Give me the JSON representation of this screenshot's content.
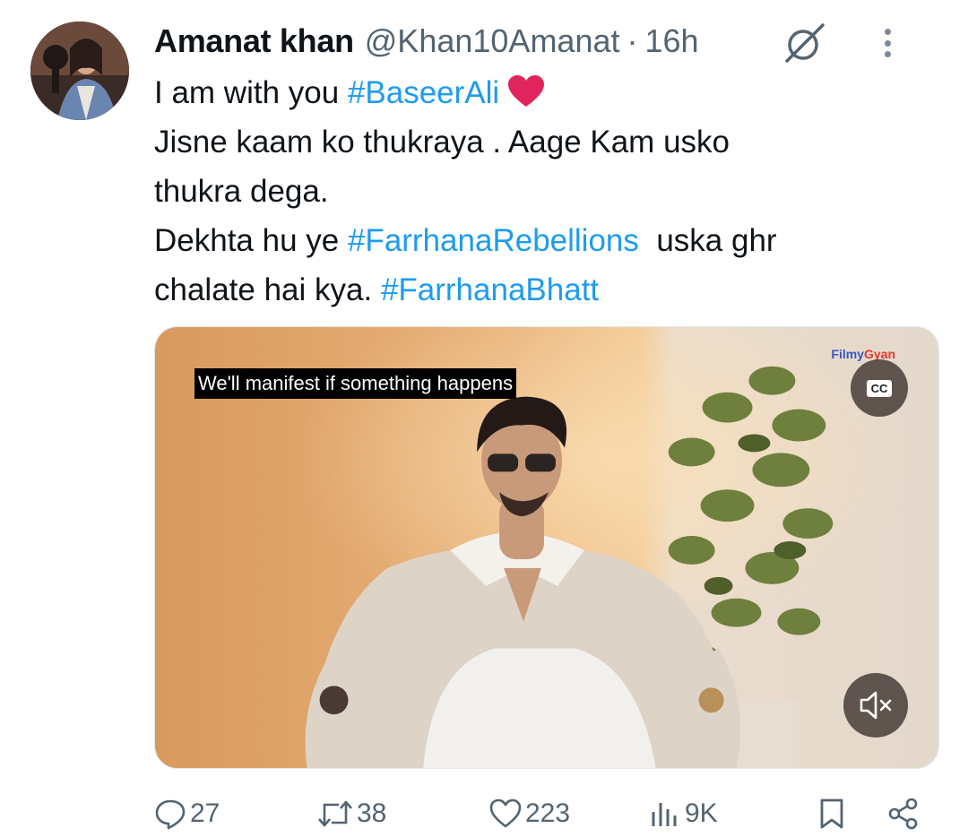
{
  "tweet": {
    "author_name": "Amanat khan",
    "handle": "@Khan10Amanat",
    "separator": "·",
    "time": "16h",
    "lines": {
      "l1_text": "I am with you ",
      "l1_tag": "#BaseerAli",
      "l1_emoji": "❤️",
      "l2": "Jisne kaam ko thukraya . Aage Kam usko",
      "l3": "thukra dega.",
      "l4_text": "Dekhta hu ye ",
      "l4_tag": "#FarrhanaRebellions",
      "l4_after": "  uska ghr",
      "l5_text": "chalate hai kya. ",
      "l5_tag": "#FarrhanaBhatt"
    }
  },
  "media": {
    "caption": "We'll manifest if something happens",
    "watermark_1": "Filmy",
    "watermark_2": "Gyan",
    "cc_label": "CC",
    "mute_icon": "speaker-muted-icon"
  },
  "actions": {
    "replies": "27",
    "reposts": "38",
    "likes": "223",
    "views": "9K"
  },
  "colors": {
    "accent": "#1d9bf0",
    "muted_text": "#536471",
    "heart": "#e0245e"
  }
}
